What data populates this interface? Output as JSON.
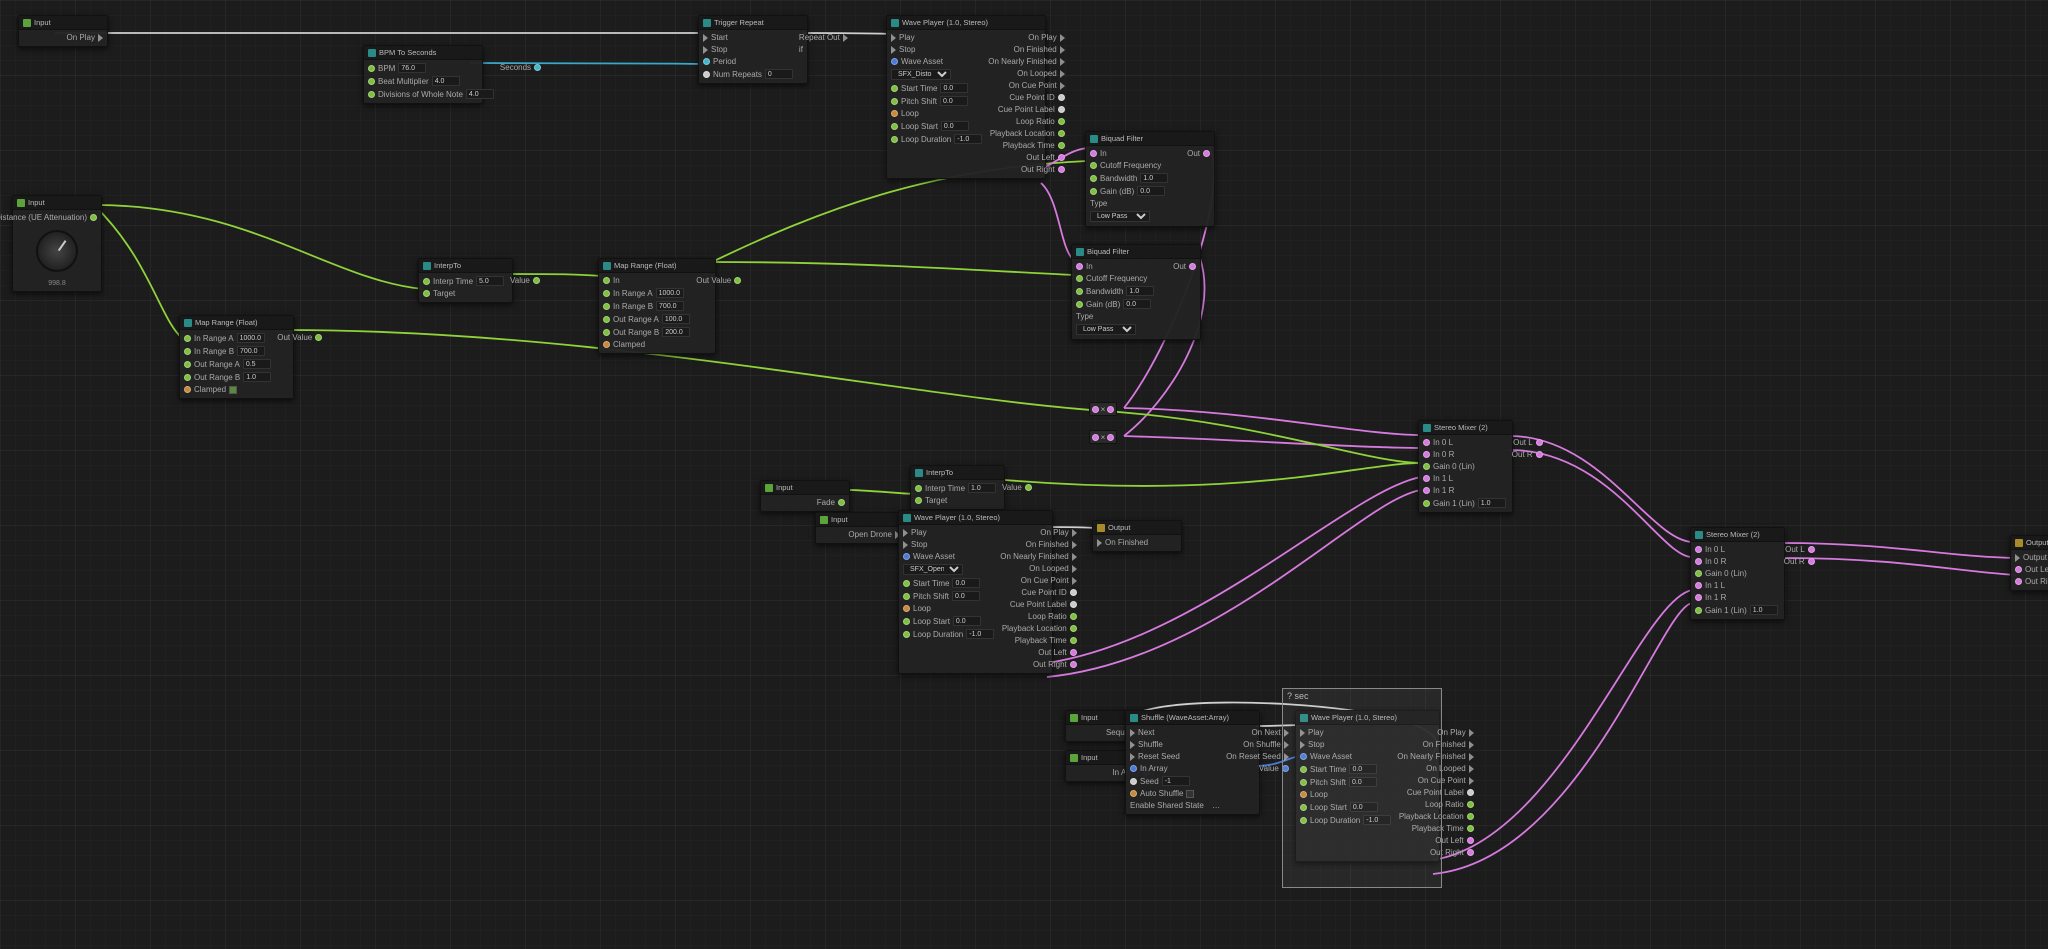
{
  "input_onplay": {
    "title": "Input",
    "pin": "On Play"
  },
  "input_distance": {
    "title": "Input",
    "pin": "Distance (UE Attenuation)",
    "label": "998.8"
  },
  "input_fade": {
    "title": "Input",
    "pin": "Fade"
  },
  "input_opendrone": {
    "title": "Input",
    "pin": "Open Drone"
  },
  "input_sequence": {
    "title": "Input",
    "pin": "Sequence"
  },
  "input_inarray": {
    "title": "Input",
    "pin": "In Array"
  },
  "bpm": {
    "title": "BPM To Seconds",
    "bpm": "BPM",
    "bpm_v": "76.0",
    "beatmul": "Beat Multiplier",
    "beatmul_v": "4.0",
    "divisions": "Divisions of Whole Note",
    "divisions_v": "4.0",
    "out": "Seconds"
  },
  "trigger_repeat": {
    "title": "Trigger Repeat",
    "start": "Start",
    "stop": "Stop",
    "period": "Period",
    "numrepeats": "Num Repeats",
    "numrepeats_v": "0",
    "repeatout": "Repeat Out"
  },
  "wave1": {
    "title": "Wave Player (1.0, Stereo)",
    "play": "Play",
    "stop": "Stop",
    "wave": "Wave Asset",
    "wave_v": "SFX_Distorted_…",
    "starttime": "Start Time",
    "starttime_v": "0.0",
    "pitch": "Pitch Shift",
    "pitch_v": "0.0",
    "loop": "Loop",
    "loopstart": "Loop Start",
    "loopstart_v": "0.0",
    "loopdur": "Loop Duration",
    "loopdur_v": "-1.0",
    "onplay": "On Play",
    "onfinished": "On Finished",
    "onnearly": "On Nearly Finished",
    "onlooped": "On Looped",
    "oncue": "On Cue Point",
    "cueid": "Cue Point ID",
    "cuelbl": "Cue Point Label",
    "loopratio": "Loop Ratio",
    "pbloc": "Playback Location",
    "pbtime": "Playback Time",
    "outl": "Out Left",
    "outr": "Out Right"
  },
  "wave2": {
    "title": "Wave Player (1.0, Stereo)",
    "wave_v": "SFX_Open_Dron…"
  },
  "wave3": {
    "title": "Wave Player (1.0, Stereo)"
  },
  "biquad1": {
    "title": "Biquad Filter",
    "in": "In",
    "cutoff": "Cutoff Frequency",
    "bw": "Bandwidth",
    "bw_v": "1.0",
    "gain": "Gain (dB)",
    "gain_v": "0.0",
    "type": "Type",
    "type_v": "Low Pass",
    "out": "Out"
  },
  "biquad2": {
    "title": "Biquad Filter"
  },
  "interp1": {
    "title": "InterpTo",
    "interptime": "Interp Time",
    "interptime_v": "5.0",
    "target": "Target",
    "value": "Value"
  },
  "interp2": {
    "title": "InterpTo",
    "interptime_v": "1.0"
  },
  "map1": {
    "title": "Map Range (Float)",
    "inA": "In Range A",
    "inA_v": "1000.0",
    "inB": "In Range B",
    "inB_v": "700.0",
    "outA": "Out Range A",
    "outA_v": "0.5",
    "outB": "Out Range B",
    "outB_v": "1.0",
    "clamped": "Clamped",
    "out": "Out Value"
  },
  "map2": {
    "title": "Map Range (Float)",
    "in": "In",
    "inA": "In Range A",
    "inA_v": "1000.0",
    "inB": "In Range B",
    "inB_v": "700.0",
    "outA": "Out Range A",
    "outA_v": "100.0",
    "outB": "Out Range B",
    "outB_v": "200.0",
    "clamped": "Clamped",
    "out": "Out Value"
  },
  "mixer1": {
    "title": "Stereo Mixer (2)",
    "in0l": "In 0 L",
    "in0r": "In 0 R",
    "gain0": "Gain 0 (Lin)",
    "gain0_v": "",
    "in1l": "In 1 L",
    "in1r": "In 1 R",
    "gain1": "Gain 1 (Lin)",
    "gain1_v": "1.0",
    "outl": "Out L",
    "outr": "Out R"
  },
  "mixer2": {
    "title": "Stereo Mixer (2)",
    "gain1_v": "1.0"
  },
  "shuffle": {
    "title": "Shuffle (WaveAsset:Array)",
    "next": "Next",
    "shuffle": "Shuffle",
    "resetseed": "Reset Seed",
    "inarray": "In Array",
    "seed": "Seed",
    "seed_v": "-1",
    "autoshuffle": "Auto Shuffle",
    "sharedstate": "Enable Shared State",
    "sharedstate_v": "…",
    "onnext": "On Next",
    "onshuffle": "On Shuffle",
    "onresetseed": "On Reset Seed",
    "value": "Value"
  },
  "output_node": {
    "title": "Output",
    "onfinished": "On Finished"
  },
  "output_final": {
    "title": "Output",
    "output": "Output",
    "outleft": "Out Left",
    "outright": "Out Right"
  },
  "selection": {
    "label": "? sec"
  }
}
